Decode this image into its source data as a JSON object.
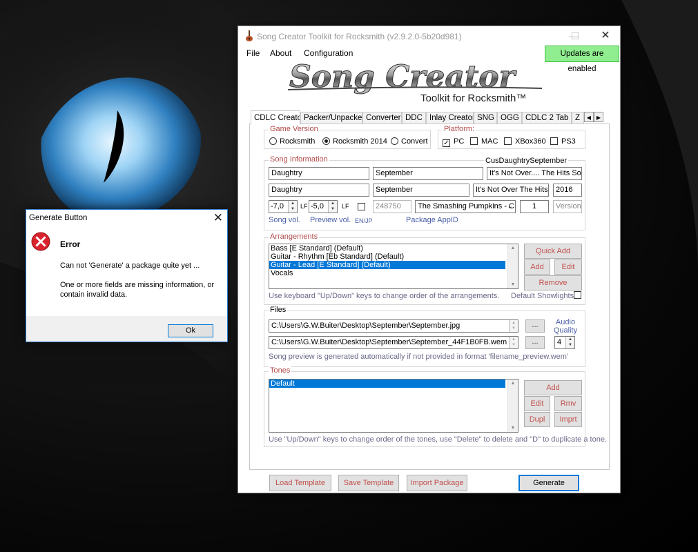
{
  "main_window": {
    "title": "Song Creator Toolkit for Rocksmith (v2.9.2.0-5b20d981)",
    "controls": {
      "minimize": "—",
      "maximize": "☐",
      "close": "✕"
    },
    "menu": [
      "File",
      "About",
      "Configuration"
    ],
    "updates_badge": "Updates are enabled",
    "logo_text": "Song Creator",
    "logo_subtitle": "Toolkit for Rocksmith™",
    "tabs": [
      "CDLC Creator",
      "Packer/Unpacker",
      "Converter",
      "DDC",
      "Inlay Creator",
      "SNG",
      "OGG",
      "CDLC 2 Tab",
      "Z"
    ],
    "tab_scroll": {
      "left": "◀",
      "right": "▶"
    },
    "game_version": {
      "title": "Game Version",
      "options": [
        "Rocksmith",
        "Rocksmith 2014",
        "Convert"
      ],
      "selected": "Rocksmith 2014"
    },
    "platform": {
      "title": "Platform:",
      "options": [
        {
          "label": "PC",
          "checked": true
        },
        {
          "label": "MAC",
          "checked": false
        },
        {
          "label": "XBox360",
          "checked": false
        },
        {
          "label": "PS3",
          "checked": false
        }
      ]
    },
    "song_info": {
      "title": "Song Information",
      "dlc_key": "CusDaughtrySeptember",
      "artist": "Daughtry",
      "song_title": "September",
      "album": "It's Not Over.... The Hits So",
      "artist_sort": "Daughtry",
      "title_sort": "September",
      "album_sort": "It's Not Over The Hits S",
      "year": "2016",
      "song_vol": "-7,0",
      "preview_vol": "-5,0",
      "lf": "LF",
      "app_id": "248750",
      "app_combo": "The Smashing Pumpkins - C",
      "version_num": "1",
      "version_placeholder": "Version",
      "song_vol_label": "Song vol.",
      "preview_vol_label": "Preview vol.",
      "enjp_label": "EN/JP",
      "appid_label": "Package AppID"
    },
    "arrangements": {
      "title": "Arrangements",
      "items": [
        "Bass [E Standard] (Default)",
        "Guitar - Rhythm [Eb Standard] (Default)",
        "Guitar - Lead [E Standard] (Default)",
        "Vocals"
      ],
      "selected_index": 2,
      "quick_add": "Quick Add",
      "add": "Add",
      "edit": "Edit",
      "remove": "Remove",
      "hint": "Use keyboard \"Up/Down\" keys to change order of the arrangements.",
      "showlights_label": "Default Showlights"
    },
    "files": {
      "title": "Files",
      "album_art": "C:\\Users\\G.W.Buiter\\Desktop\\September\\September.jpg",
      "audio": "C:\\Users\\G.W.Buiter\\Desktop\\September\\September_44F1B0FB.wem",
      "browse": "...",
      "audio_quality_label": "Audio Quality",
      "audio_quality": "4",
      "hint": "Song preview is generated automatically if not provided in format 'filename_preview.wem'"
    },
    "tones": {
      "title": "Tones",
      "items": [
        "Default"
      ],
      "selected_index": 0,
      "add": "Add",
      "edit": "Edit",
      "rmv": "Rmv",
      "dupl": "Dupl",
      "imprt": "Imprt",
      "hint": "Use \"Up/Down\" keys to change order of the tones, use \"Delete\" to delete and \"D\" to duplicate a tone."
    },
    "footer": {
      "load_template": "Load Template",
      "save_template": "Save Template",
      "import_package": "Import Package",
      "generate": "Generate"
    }
  },
  "dialog": {
    "title": "Generate Button",
    "close": "✕",
    "heading": "Error",
    "message_1": "Can not 'Generate' a package quite yet ...",
    "message_2": "One or more fields are missing information, or contain invalid data.",
    "ok": "Ok"
  },
  "colors": {
    "accent": "#0078d7",
    "updates_badge": "#90ee90",
    "group_title": "#b04a4a",
    "button_text": "#c0504d",
    "error_icon": "#d9232d"
  }
}
